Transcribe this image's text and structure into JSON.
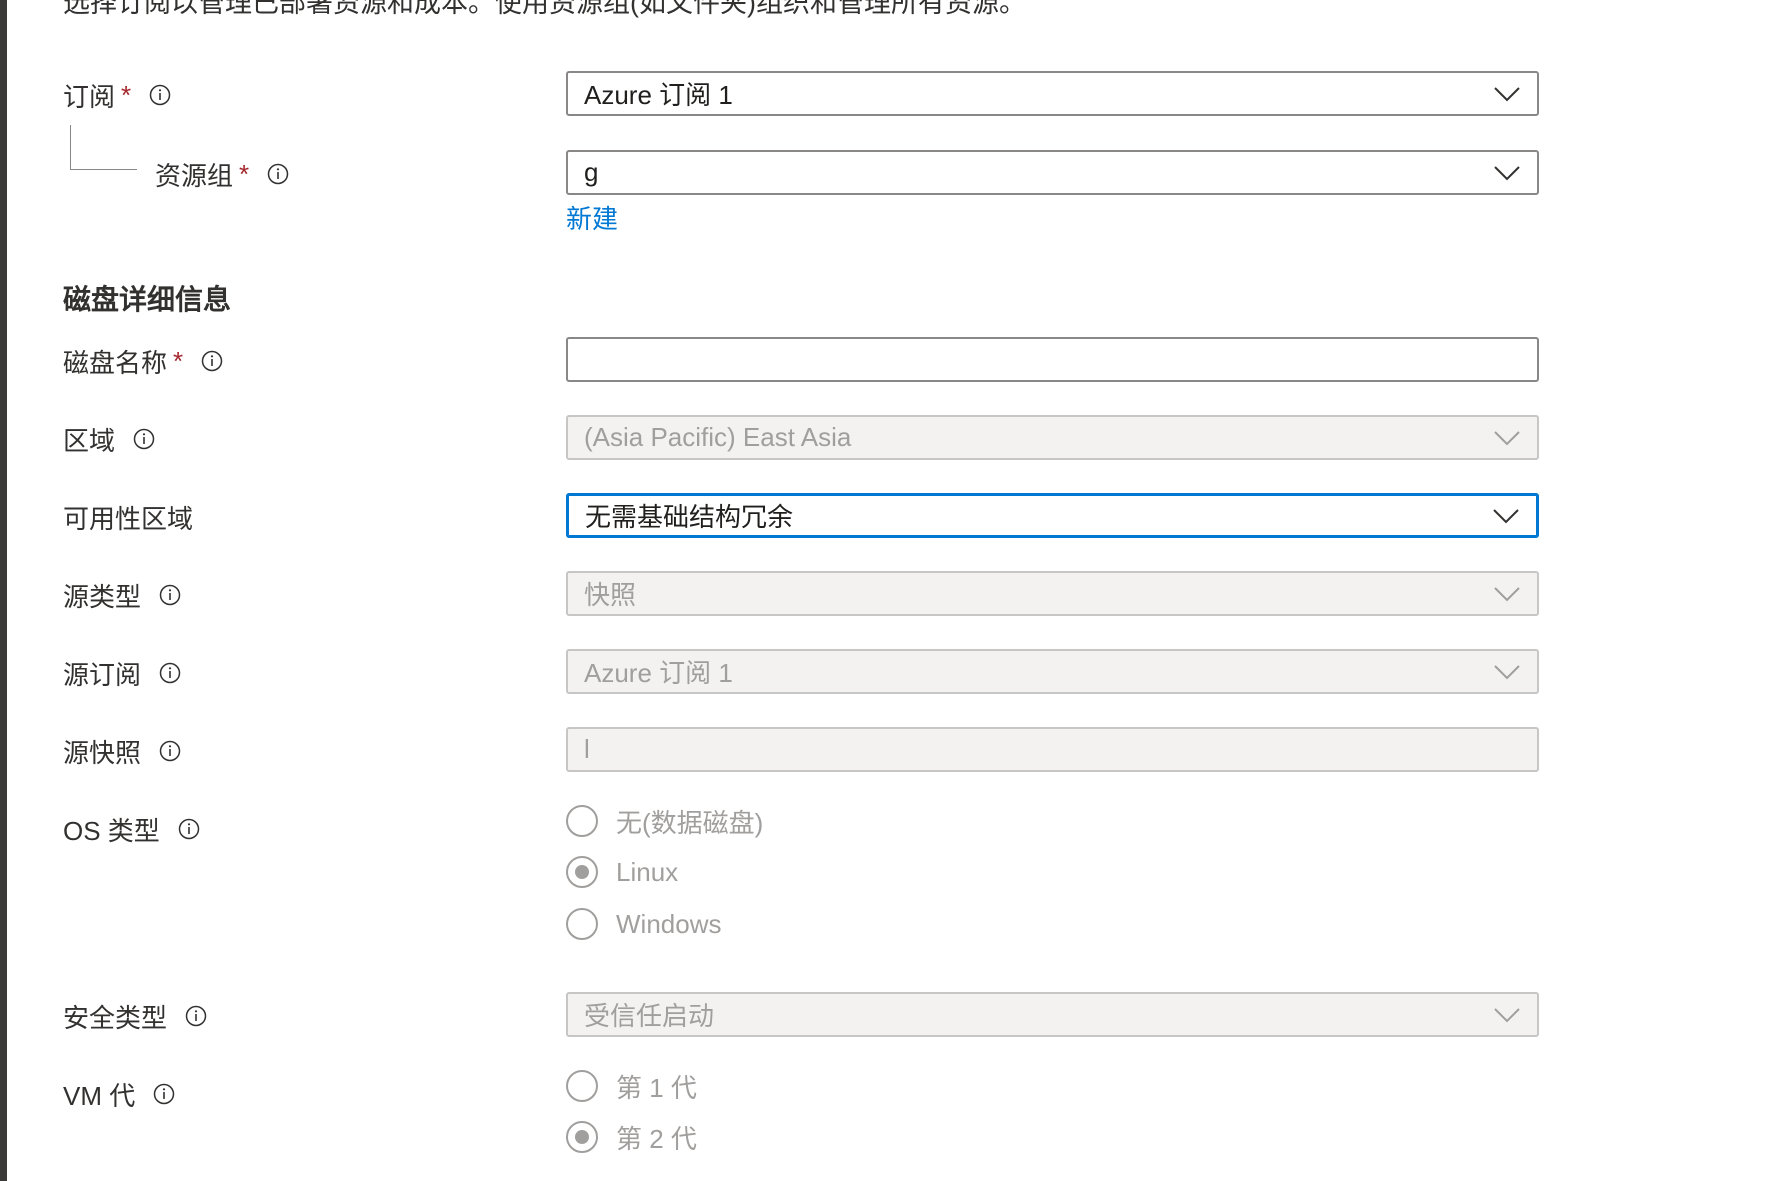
{
  "intro_text": "选择订阅以管理已部署资源和成本。使用资源组(如文件夹)组织和管理所有资源。",
  "project": {
    "subscription": {
      "label": "订阅",
      "value": "Azure 订阅 1"
    },
    "resource_group": {
      "label": "资源组",
      "value": "g",
      "create_new_link": "新建"
    }
  },
  "required_mark": "*",
  "disk_details": {
    "heading": "磁盘详细信息",
    "disk_name": {
      "label": "磁盘名称",
      "value": ""
    },
    "region": {
      "label": "区域",
      "value": "(Asia Pacific) East Asia"
    },
    "availability_zone": {
      "label": "可用性区域",
      "value": "无需基础结构冗余"
    },
    "source_type": {
      "label": "源类型",
      "value": "快照"
    },
    "source_subscription": {
      "label": "源订阅",
      "value": "Azure 订阅 1"
    },
    "source_snapshot": {
      "label": "源快照",
      "value": "l"
    },
    "os_type": {
      "label": "OS 类型",
      "options": [
        "无(数据磁盘)",
        "Linux",
        "Windows"
      ],
      "selected": "Linux"
    },
    "security_type": {
      "label": "安全类型",
      "value": "受信任启动"
    },
    "vm_generation": {
      "label": "VM 代",
      "options": [
        "第 1 代",
        "第 2 代"
      ],
      "selected": "第 2 代"
    }
  },
  "colors": {
    "accent": "#0078d4",
    "required": "#a4262c",
    "disabled_bg": "#f3f2f1",
    "text": "#323130"
  },
  "icons": {
    "info": "info-icon",
    "dropdown": "chevron-down-icon"
  }
}
